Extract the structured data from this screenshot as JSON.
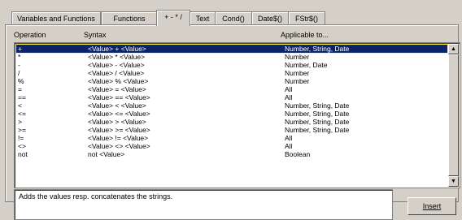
{
  "tabs": [
    {
      "label": "Variables and Functions"
    },
    {
      "label": "Functions"
    },
    {
      "label": "+ - * /"
    },
    {
      "label": "Text"
    },
    {
      "label": "Cond()"
    },
    {
      "label": "Date$()"
    },
    {
      "label": "FStr$()"
    }
  ],
  "columns": {
    "operation": "Operation",
    "syntax": "Syntax",
    "applicable": "Applicable to..."
  },
  "rows": [
    {
      "op": "+",
      "syntax": "<Value> + <Value>",
      "applicable": "Number, String, Date"
    },
    {
      "op": "*",
      "syntax": "<Value> * <Value>",
      "applicable": "Number"
    },
    {
      "op": "-",
      "syntax": "<Value> - <Value>",
      "applicable": "Number, Date"
    },
    {
      "op": "/",
      "syntax": "<Value> / <Value>",
      "applicable": "Number"
    },
    {
      "op": "%",
      "syntax": "<Value> % <Value>",
      "applicable": "Number"
    },
    {
      "op": "=",
      "syntax": "<Value> = <Value>",
      "applicable": "All"
    },
    {
      "op": "==",
      "syntax": "<Value> == <Value>",
      "applicable": "All"
    },
    {
      "op": "<",
      "syntax": "<Value> < <Value>",
      "applicable": "Number, String, Date"
    },
    {
      "op": "<=",
      "syntax": "<Value> <= <Value>",
      "applicable": "Number, String, Date"
    },
    {
      "op": ">",
      "syntax": "<Value> > <Value>",
      "applicable": "Number, String, Date"
    },
    {
      "op": ">=",
      "syntax": "<Value> >= <Value>",
      "applicable": "Number, String, Date"
    },
    {
      "op": "!=",
      "syntax": "<Value> != <Value>",
      "applicable": "All"
    },
    {
      "op": "<>",
      "syntax": "<Value> <> <Value>",
      "applicable": "All"
    },
    {
      "op": "not",
      "syntax": "not <Value>",
      "applicable": "Boolean"
    }
  ],
  "description": "Adds the values resp. concatenates the strings.",
  "insert_label": "Insert",
  "scroll_up_icon": "▲",
  "scroll_down_icon": "▼"
}
